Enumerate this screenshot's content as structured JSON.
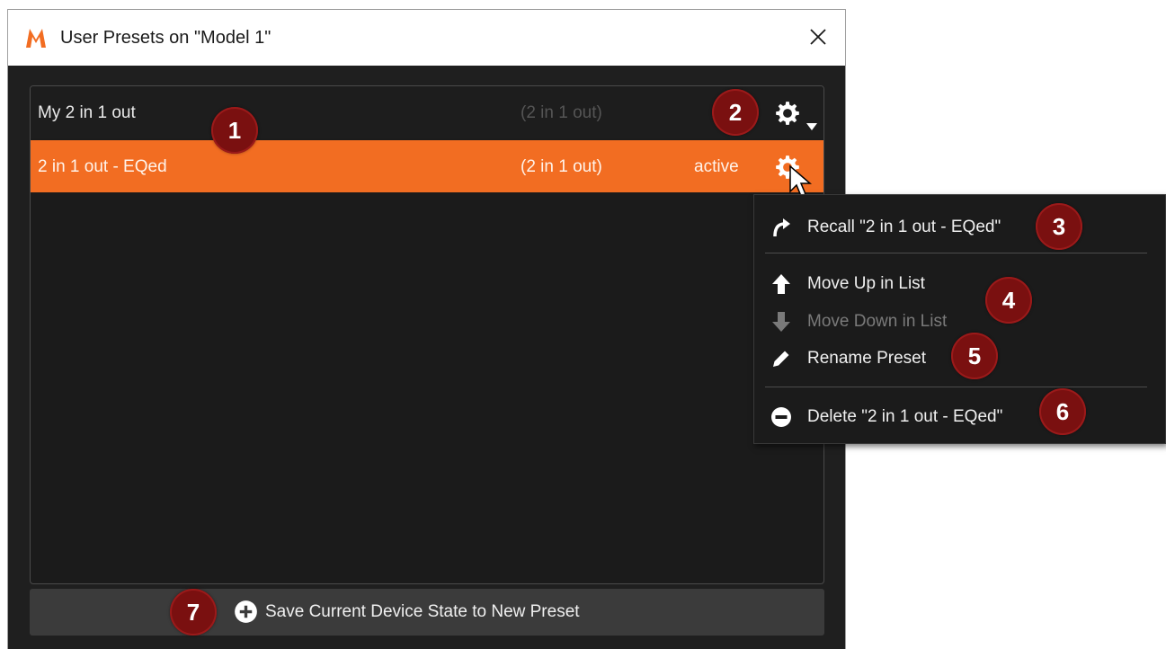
{
  "window": {
    "title": "User Presets on \"Model 1\"",
    "logo_color": "#f26d22"
  },
  "presets": [
    {
      "name": "My 2 in 1 out",
      "io": "(2 in 1 out)",
      "status": "",
      "selected": false
    },
    {
      "name": "2 in 1 out - EQed",
      "io": "(2 in 1 out)",
      "status": "active",
      "selected": true
    }
  ],
  "context_menu": {
    "items": [
      {
        "label": "Recall \"2 in 1 out - EQed\"",
        "icon": "recall-arrow-icon",
        "enabled": true
      },
      {
        "label": "Move Up in List",
        "icon": "arrow-up-icon",
        "enabled": true
      },
      {
        "label": "Move Down in List",
        "icon": "arrow-down-icon",
        "enabled": false
      },
      {
        "label": "Rename Preset",
        "icon": "pencil-icon",
        "enabled": true
      },
      {
        "label": "Delete \"2 in 1 out - EQed\"",
        "icon": "minus-circle-icon",
        "enabled": true
      }
    ]
  },
  "save_button": {
    "label": "Save Current Device State to New Preset",
    "icon": "plus-circle-icon"
  },
  "callouts": [
    "1",
    "2",
    "3",
    "4",
    "5",
    "6",
    "7"
  ],
  "colors": {
    "accent": "#f26d22",
    "badge": "#7a1010",
    "background": "#1f1f1f"
  }
}
